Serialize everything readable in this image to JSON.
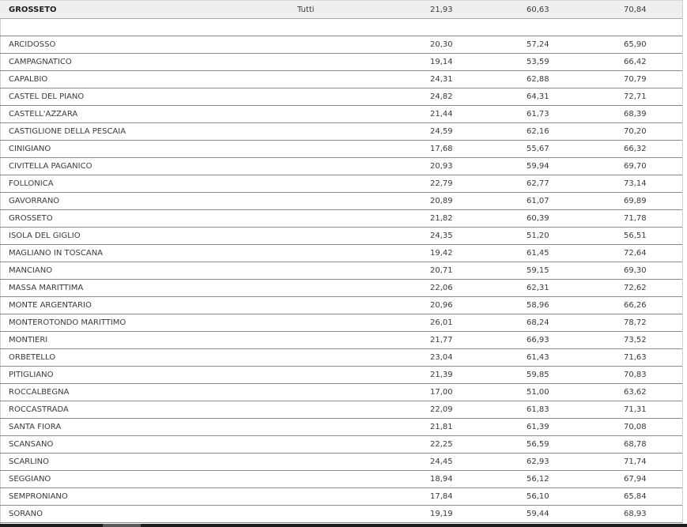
{
  "header": {
    "name": "GROSSETO",
    "category": "Tutti",
    "v1": "21,93",
    "v2": "60,63",
    "v3": "70,84"
  },
  "rows": [
    {
      "name": "ARCIDOSSO",
      "v1": "20,30",
      "v2": "57,24",
      "v3": "65,90"
    },
    {
      "name": "CAMPAGNATICO",
      "v1": "19,14",
      "v2": "53,59",
      "v3": "66,42"
    },
    {
      "name": "CAPALBIO",
      "v1": "24,31",
      "v2": "62,88",
      "v3": "70,79"
    },
    {
      "name": "CASTEL DEL PIANO",
      "v1": "24,82",
      "v2": "64,31",
      "v3": "72,71"
    },
    {
      "name": "CASTELL'AZZARA",
      "v1": "21,44",
      "v2": "61,73",
      "v3": "68,39"
    },
    {
      "name": "CASTIGLIONE DELLA PESCAIA",
      "v1": "24,59",
      "v2": "62,16",
      "v3": "70,20"
    },
    {
      "name": "CINIGIANO",
      "v1": "17,68",
      "v2": "55,67",
      "v3": "66,32"
    },
    {
      "name": "CIVITELLA PAGANICO",
      "v1": "20,93",
      "v2": "59,94",
      "v3": "69,70"
    },
    {
      "name": "FOLLONICA",
      "v1": "22,79",
      "v2": "62,77",
      "v3": "73,14"
    },
    {
      "name": "GAVORRANO",
      "v1": "20,89",
      "v2": "61,07",
      "v3": "69,89"
    },
    {
      "name": "GROSSETO",
      "v1": "21,82",
      "v2": "60,39",
      "v3": "71,78"
    },
    {
      "name": "ISOLA DEL GIGLIO",
      "v1": "24,35",
      "v2": "51,20",
      "v3": "56,51"
    },
    {
      "name": "MAGLIANO IN TOSCANA",
      "v1": "19,42",
      "v2": "61,45",
      "v3": "72,64"
    },
    {
      "name": "MANCIANO",
      "v1": "20,71",
      "v2": "59,15",
      "v3": "69,30"
    },
    {
      "name": "MASSA MARITTIMA",
      "v1": "22,06",
      "v2": "62,31",
      "v3": "72,62"
    },
    {
      "name": "MONTE ARGENTARIO",
      "v1": "20,96",
      "v2": "58,96",
      "v3": "66,26"
    },
    {
      "name": "MONTEROTONDO MARITTIMO",
      "v1": "26,01",
      "v2": "68,24",
      "v3": "78,72"
    },
    {
      "name": "MONTIERI",
      "v1": "21,77",
      "v2": "66,93",
      "v3": "73,52"
    },
    {
      "name": "ORBETELLO",
      "v1": "23,04",
      "v2": "61,43",
      "v3": "71,63"
    },
    {
      "name": "PITIGLIANO",
      "v1": "21,39",
      "v2": "59,85",
      "v3": "70,83"
    },
    {
      "name": "ROCCALBEGNA",
      "v1": "17,00",
      "v2": "51,00",
      "v3": "63,62"
    },
    {
      "name": "ROCCASTRADA",
      "v1": "22,09",
      "v2": "61,83",
      "v3": "71,31"
    },
    {
      "name": "SANTA FIORA",
      "v1": "21,81",
      "v2": "61,39",
      "v3": "70,08"
    },
    {
      "name": "SCANSANO",
      "v1": "22,25",
      "v2": "56,59",
      "v3": "68,78"
    },
    {
      "name": "SCARLINO",
      "v1": "24,45",
      "v2": "62,93",
      "v3": "71,74"
    },
    {
      "name": "SEGGIANO",
      "v1": "18,94",
      "v2": "56,12",
      "v3": "67,94"
    },
    {
      "name": "SEMPRONIANO",
      "v1": "17,84",
      "v2": "56,10",
      "v3": "65,84"
    },
    {
      "name": "SORANO",
      "v1": "19,19",
      "v2": "59,44",
      "v3": "68,93"
    }
  ]
}
